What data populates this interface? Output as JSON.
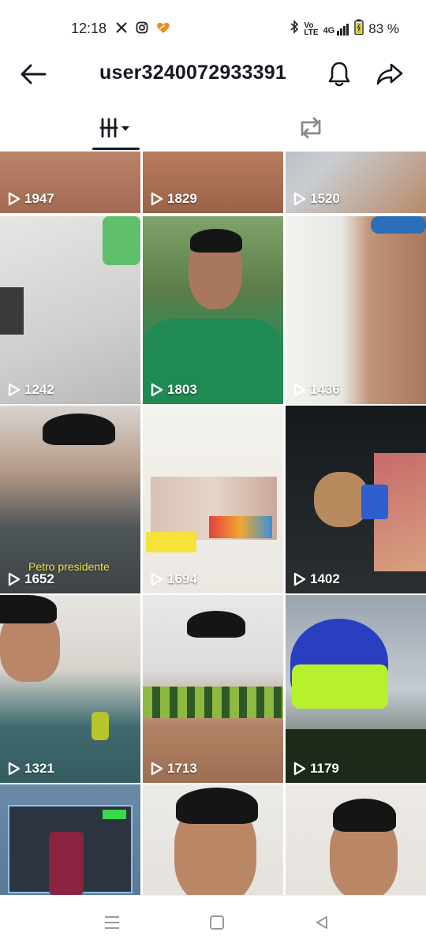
{
  "status": {
    "time": "12:18",
    "app_icons": [
      "x-icon",
      "instagram-icon",
      "app-heart-icon"
    ],
    "network": "4G",
    "battery": "83 %"
  },
  "header": {
    "username": "user3240072933391"
  },
  "tabs": [
    {
      "name": "videos",
      "active": true
    },
    {
      "name": "reposts",
      "active": false
    }
  ],
  "videos": [
    {
      "views": "1947",
      "caption": ""
    },
    {
      "views": "1829",
      "caption": ""
    },
    {
      "views": "1520",
      "caption": ""
    },
    {
      "views": "1242",
      "caption": ""
    },
    {
      "views": "1803",
      "caption": ""
    },
    {
      "views": "1436",
      "caption": ""
    },
    {
      "views": "1652",
      "caption": "Petro presidente"
    },
    {
      "views": "1694",
      "caption": ""
    },
    {
      "views": "1402",
      "caption": ""
    },
    {
      "views": "1321",
      "caption": ""
    },
    {
      "views": "1713",
      "caption": ""
    },
    {
      "views": "1179",
      "caption": ""
    },
    {
      "views": "",
      "caption": ""
    },
    {
      "views": "",
      "caption": ""
    },
    {
      "views": "",
      "caption": ""
    }
  ],
  "colors": {
    "text": "#161823",
    "accent": "#fe2c55",
    "caption": "#f4e64a"
  }
}
